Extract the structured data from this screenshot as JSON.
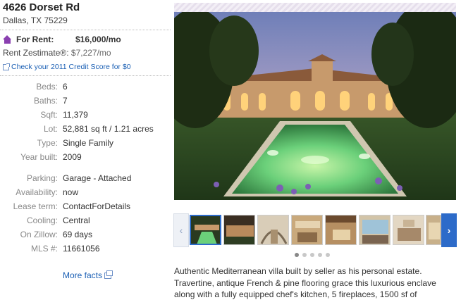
{
  "listing": {
    "address_line1": "4626 Dorset Rd",
    "address_line2": "Dallas, TX 75229",
    "rent_label": "For Rent:",
    "rent_value": "$16,000/mo",
    "zestimate_label": "Rent Zestimate®:",
    "zestimate_value": "$7,227/mo",
    "credit_link": "Check your 2011 Credit Score for $0"
  },
  "facts_group1": [
    {
      "label": "Beds:",
      "value": "6"
    },
    {
      "label": "Baths:",
      "value": "7"
    },
    {
      "label": "Sqft:",
      "value": "11,379"
    },
    {
      "label": "Lot:",
      "value": "52,881 sq ft / 1.21 acres"
    },
    {
      "label": "Type:",
      "value": "Single Family"
    },
    {
      "label": "Year built:",
      "value": "2009"
    }
  ],
  "facts_group2": [
    {
      "label": "Parking:",
      "value": "Garage - Attached"
    },
    {
      "label": "Availability:",
      "value": "now"
    },
    {
      "label": "Lease term:",
      "value": "ContactForDetails"
    },
    {
      "label": "Cooling:",
      "value": "Central"
    },
    {
      "label": "On Zillow:",
      "value": "69 days"
    },
    {
      "label": "MLS #:",
      "value": "11661056"
    }
  ],
  "more_facts_link": "More facts",
  "gallery": {
    "prev_glyph": "‹",
    "next_glyph": "›",
    "dot_count": 5,
    "active_dot": 0,
    "active_thumb": 0
  },
  "description": "Authentic Mediterranean villa built by seller as his personal estate. Travertine, antique French & pine flooring grace this luxurious enclave along with a fully equipped chef's kitchen, 5 fireplaces, 1500 sf of",
  "colors": {
    "accent": "#8a3fb0",
    "link": "#1a5fb4",
    "nav_active": "#2d6bc9"
  }
}
